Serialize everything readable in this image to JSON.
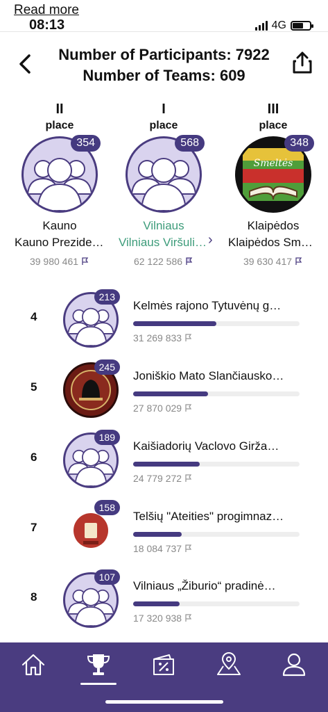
{
  "status_bar": {
    "link": "Read more",
    "time": "08:13",
    "network": "4G"
  },
  "header": {
    "participants": "Number of Participants: 7922",
    "teams": "Number of Teams: 609",
    "back_icon": "chevron-left-icon",
    "share_icon": "share-icon"
  },
  "podium": [
    {
      "roman": "II",
      "place": "place",
      "count": "354",
      "name": "Kauno Prezidento…",
      "score": "39 980 461"
    },
    {
      "roman": "I",
      "place": "place",
      "count": "568",
      "name": "Vilniaus Viršuliškių p…",
      "score": "62 122 586",
      "highlight": "#3d9c7a"
    },
    {
      "roman": "III",
      "place": "place",
      "count": "348",
      "name": "Klaipėdos Smeltės pro…",
      "score": "39 630 417"
    }
  ],
  "rankings": [
    {
      "rank": "4",
      "count": "213",
      "name": "Kelmės rajono Tytuvėnų g…",
      "score": "31 269 833",
      "progress": 0.5
    },
    {
      "rank": "5",
      "count": "245",
      "name": "Joniškio Mato Slančiausko…",
      "score": "27 870 029",
      "progress": 0.45
    },
    {
      "rank": "6",
      "count": "189",
      "name": "Kaišiadorių Vaclovo Girža…",
      "score": "24 779 272",
      "progress": 0.4
    },
    {
      "rank": "7",
      "count": "158",
      "name": "Telšių \"Ateities\" progimnaz…",
      "score": "18 084 737",
      "progress": 0.29
    },
    {
      "rank": "8",
      "count": "107",
      "name": "Vilniaus „Žiburio“ pradinė…",
      "score": "17 320 938",
      "progress": 0.28
    }
  ],
  "nav": [
    {
      "icon": "home-icon"
    },
    {
      "icon": "trophy-icon",
      "active": true
    },
    {
      "icon": "discount-ticket-icon"
    },
    {
      "icon": "map-pin-icon"
    },
    {
      "icon": "profile-icon"
    }
  ],
  "colors": {
    "accent": "#453a80",
    "nav_bg": "#4a3c80",
    "highlight": "#3d9c7a",
    "avatar_bg": "#d9d3ee"
  }
}
